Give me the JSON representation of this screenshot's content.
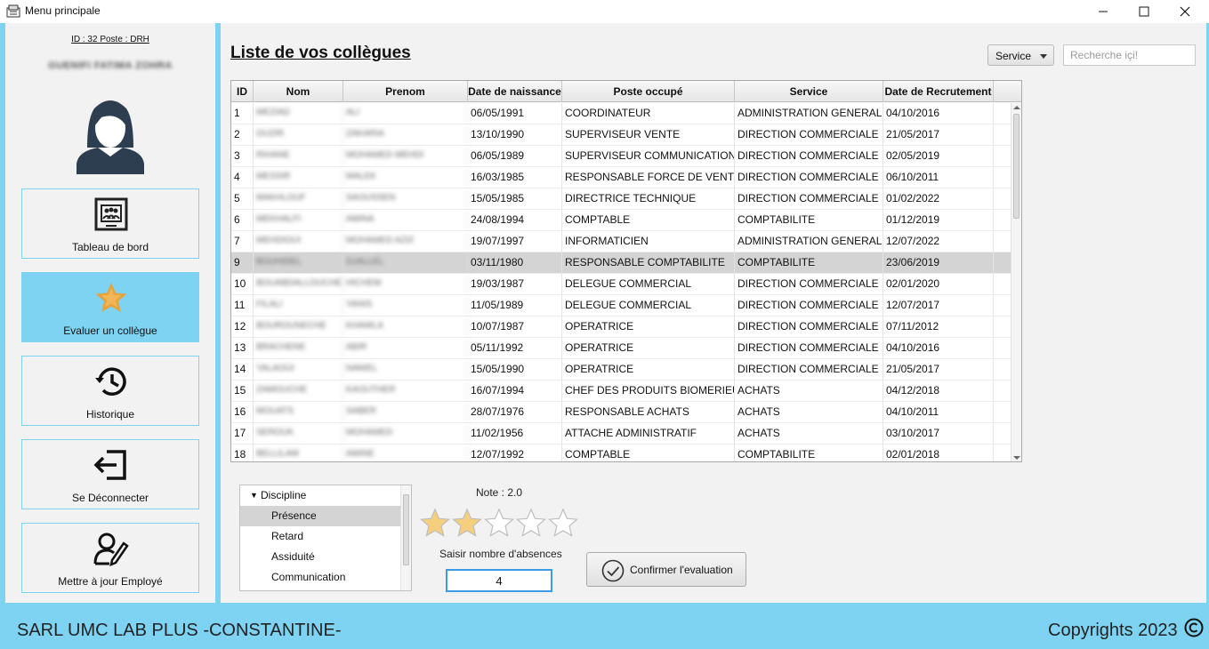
{
  "window": {
    "title": "Menu principale"
  },
  "user": {
    "id_line": "ID : 32 Poste : DRH",
    "name": "GUENIFI FATIMA ZOHRA"
  },
  "nav": [
    {
      "label": "Tableau de bord",
      "icon": "dashboard-icon"
    },
    {
      "label": "Evaluer un collègue",
      "icon": "star-icon",
      "active": true
    },
    {
      "label": "Historique",
      "icon": "history-icon"
    },
    {
      "label": "Se Déconnecter",
      "icon": "logout-icon"
    },
    {
      "label": "Mettre à jour Employé",
      "icon": "edit-user-icon"
    }
  ],
  "main": {
    "title": "Liste de vos collègues",
    "service_filter": "Service",
    "search_placeholder": "Recherche içi!"
  },
  "table": {
    "columns": [
      "ID",
      "Nom",
      "Prenom",
      "Date de naissance",
      "Poste occupé",
      "Service",
      "Date de Recrutement"
    ],
    "selected_row": 7,
    "rows": [
      [
        "1",
        "MEZIAD",
        "ALI",
        "06/05/1991",
        "COORDINATEUR",
        "ADMINISTRATION GENERALE",
        "04/10/2016"
      ],
      [
        "2",
        "OUZIR",
        "ZAKARIA",
        "13/10/1990",
        "SUPERVISEUR VENTE",
        "DIRECTION COMMERCIALE",
        "21/05/2017"
      ],
      [
        "3",
        "RIHANE",
        "MOHAMED MEHDI",
        "06/05/1989",
        "SUPERVISEUR COMMUNICATION",
        "DIRECTION COMMERCIALE",
        "02/05/2019"
      ],
      [
        "4",
        "MESSIR",
        "MALEK",
        "16/03/1985",
        "RESPONSABLE FORCE DE VENTE",
        "DIRECTION COMMERCIALE",
        "06/10/2011"
      ],
      [
        "5",
        "MAKHLOUF",
        "SAOUSSEN",
        "15/05/1985",
        "DIRECTRICE TECHNIQUE",
        "DIRECTION COMMERCIALE",
        "01/02/2022"
      ],
      [
        "6",
        "MEKHALFI",
        "AMINA",
        "24/08/1994",
        "COMPTABLE",
        "COMPTABILITE",
        "01/12/2019"
      ],
      [
        "7",
        "MEHDIOUI",
        "MOHAMED AZIZ",
        "19/07/1997",
        "INFORMATICIEN",
        "ADMINISTRATION GENERALE",
        "12/07/2022"
      ],
      [
        "9",
        "BOUHIDEL",
        "DJALLEL",
        "03/11/1980",
        "RESPONSABLE COMPTABILITE",
        "COMPTABILITE",
        "23/06/2019"
      ],
      [
        "10",
        "BOUABDALLOUCHE",
        "HICHEM",
        "19/03/1987",
        "DELEGUE COMMERCIAL",
        "DIRECTION COMMERCIALE",
        "02/01/2020"
      ],
      [
        "11",
        "FILALI",
        "YANIS",
        "11/05/1989",
        "DELEGUE COMMERCIAL",
        "DIRECTION COMMERCIALE",
        "12/07/2017"
      ],
      [
        "12",
        "BOUROUNECHE",
        "KHAWLA",
        "10/07/1987",
        "OPERATRICE",
        "DIRECTION COMMERCIALE",
        "07/11/2012"
      ],
      [
        "13",
        "BRACHENE",
        "ABIR",
        "05/11/1992",
        "OPERATRICE",
        "DIRECTION COMMERCIALE",
        "04/10/2016"
      ],
      [
        "14",
        "YALAOUI",
        "NAWEL",
        "15/05/1990",
        "OPERATRICE",
        "DIRECTION COMMERCIALE",
        "21/05/2017"
      ],
      [
        "15",
        "ZAMOUCHE",
        "KAOUTHER",
        "16/07/1994",
        "CHEF DES PRODUITS BIOMERIEUX",
        "ACHATS",
        "04/12/2018"
      ],
      [
        "16",
        "MOUATS",
        "SABER",
        "28/07/1976",
        "RESPONSABLE ACHATS",
        "ACHATS",
        "04/10/2011"
      ],
      [
        "17",
        "SEROUK",
        "MOHAMED",
        "11/02/1956",
        "ATTACHE ADMINISTRATIF",
        "ACHATS",
        "03/10/2017"
      ],
      [
        "18",
        "BELLILAM",
        "AMINE",
        "12/07/1992",
        "COMPTABLE",
        "COMPTABILITE",
        "02/01/2018"
      ]
    ]
  },
  "criteria": {
    "group": "Discipline",
    "items": [
      "Présence",
      "Retard",
      "Assiduité",
      "Communication"
    ],
    "selected_index": 0
  },
  "rating": {
    "label": "Note : 2.0",
    "value": 2,
    "max": 5
  },
  "absences": {
    "label": "Saisir nombre d'absences",
    "value": "4"
  },
  "confirm_label": "Confirmer l'evaluation",
  "footer": {
    "company": "SARL UMC LAB PLUS -CONSTANTINE-",
    "copyright": "Copyrights 2023"
  },
  "colors": {
    "accent": "#7dd3f1",
    "star_filled": "#f5cf7e",
    "star_empty": "#ffffff",
    "selection": "#d4d4d4"
  }
}
